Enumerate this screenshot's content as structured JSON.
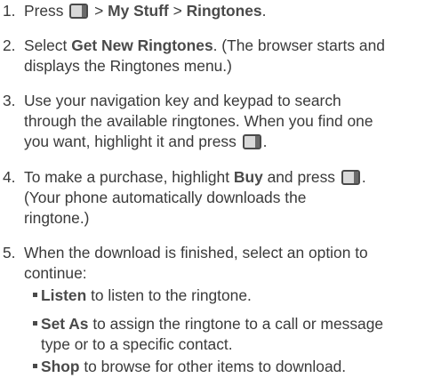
{
  "steps": [
    {
      "number": "1.",
      "parts": {
        "a": "Press",
        "sep1": ">",
        "b": "My Stuff",
        "sep2": ">",
        "c": "Ringtones",
        "end": "."
      }
    },
    {
      "number": "2.",
      "parts": {
        "a": "Select",
        "b": "Get New Ringtones",
        "c": ". (The browser starts and",
        "d": "displays the Ringtones menu.)"
      }
    },
    {
      "number": "3.",
      "lines": [
        "Use your navigation key and keypad to search",
        "through the available ringtones. When you find one",
        "you want, highlight it and press"
      ],
      "end": "."
    },
    {
      "number": "4.",
      "parts": {
        "a": "To make a purchase, highlight",
        "b": "Buy",
        "c": "and press",
        "end": ".",
        "d": "(Your phone automatically downloads the",
        "e": "ringtone.)"
      }
    },
    {
      "number": "5.",
      "lines": [
        "When the download is finished, select an option to",
        "continue:"
      ]
    }
  ],
  "options": [
    {
      "label": "Listen",
      "text": "to listen to the ringtone."
    },
    {
      "label": "Set As",
      "text": "to assign the ringtone to a call or message",
      "text2": "type or to a specific contact."
    },
    {
      "label": "Shop",
      "text": "to browse for other items to download."
    }
  ],
  "icons": {
    "menu_key": "menu-key-icon",
    "ok_key": "ok-key-icon",
    "bullet": "square-bullet-icon"
  },
  "colors": {
    "text": "#3a3a3a",
    "key_fill": "#d9d9d9",
    "key_border": "#4a4a4a"
  }
}
